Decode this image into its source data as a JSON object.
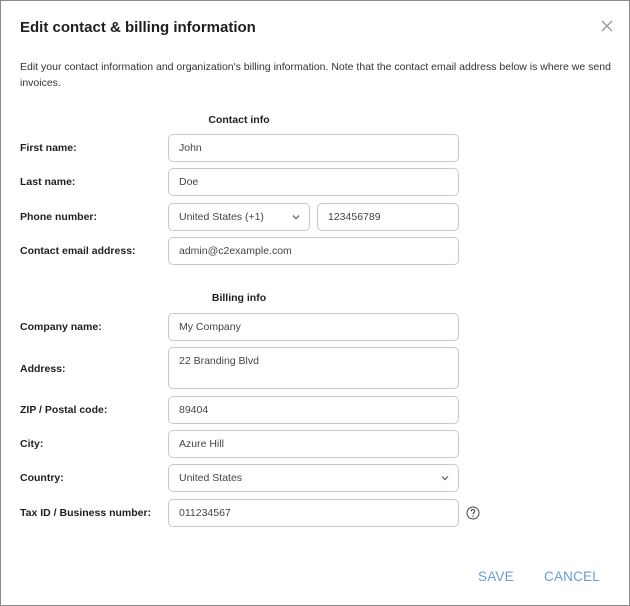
{
  "dialog": {
    "title": "Edit contact & billing information",
    "description": "Edit your contact information and organization's billing information. Note that the contact email address below is where we send invoices."
  },
  "contact": {
    "heading": "Contact info",
    "first_name": {
      "label": "First name:",
      "value": "John"
    },
    "last_name": {
      "label": "Last name:",
      "value": "Doe"
    },
    "phone": {
      "label": "Phone number:",
      "country_code": "United States (+1)",
      "number": "123456789"
    },
    "email": {
      "label": "Contact email address:",
      "value": "admin@c2example.com"
    }
  },
  "billing": {
    "heading": "Billing info",
    "company": {
      "label": "Company name:",
      "value": "My Company"
    },
    "address": {
      "label": "Address:",
      "value": "22 Branding Blvd"
    },
    "zip": {
      "label": "ZIP / Postal code:",
      "value": "89404"
    },
    "city": {
      "label": "City:",
      "value": "Azure Hill"
    },
    "country": {
      "label": "Country:",
      "value": "United States"
    },
    "tax_id": {
      "label": "Tax ID / Business number:",
      "value": "011234567"
    }
  },
  "actions": {
    "save": "SAVE",
    "cancel": "CANCEL"
  },
  "icons": {
    "close": "close-icon",
    "help": "help-icon",
    "dropdown": "chevron-down-icon"
  },
  "colors": {
    "action_text": "#6b9ad8",
    "field_border": "#c9c9c9",
    "dialog_border": "#8a8a8a"
  }
}
